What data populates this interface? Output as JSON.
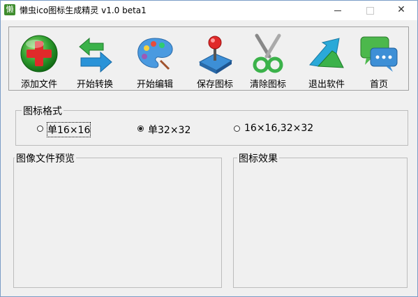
{
  "window": {
    "title": "懒虫ico图标生成精灵 v1.0 beta1",
    "app_icon_glyph": "懒",
    "controls": {
      "minimize": "minimize-icon",
      "maximize": "maximize-icon",
      "close_glyph": "✕"
    }
  },
  "toolbar": {
    "items": [
      {
        "label": "添加文件",
        "icon": "add-file-icon"
      },
      {
        "label": "开始转换",
        "icon": "convert-icon"
      },
      {
        "label": "开始编辑",
        "icon": "edit-palette-icon"
      },
      {
        "label": "保存图标",
        "icon": "save-joystick-icon"
      },
      {
        "label": "清除图标",
        "icon": "scissors-icon"
      },
      {
        "label": "退出软件",
        "icon": "exit-arrow-icon"
      },
      {
        "label": "首页",
        "icon": "home-chat-icon"
      }
    ]
  },
  "format_group": {
    "title": "图标格式",
    "options": [
      {
        "label": "单16×16",
        "checked": false
      },
      {
        "label": "单32×32",
        "checked": true
      },
      {
        "label": "16×16,32×32",
        "checked": false
      }
    ]
  },
  "preview_group": {
    "title": "图像文件预览"
  },
  "effect_group": {
    "title": "图标效果"
  },
  "colors": {
    "accent_green": "#3f8d2e",
    "border": "#bcbcbc",
    "background": "#f0f0f0"
  }
}
